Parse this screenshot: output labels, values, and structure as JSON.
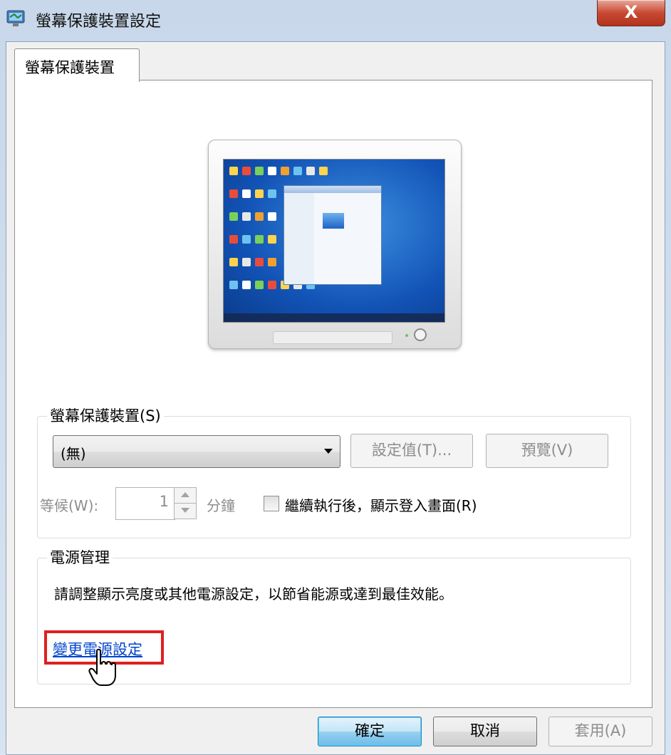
{
  "window": {
    "title": "螢幕保護裝置設定",
    "close_label": "X"
  },
  "tab": {
    "label": "螢幕保護裝置"
  },
  "screensaver": {
    "legend": "螢幕保護裝置(S)",
    "selected": "(無)",
    "settings_label": "設定值(T)...",
    "preview_label": "預覽(V)",
    "wait_label": "等候(W):",
    "wait_value": "1",
    "minutes_label": "分鐘",
    "resume_label": "繼續執行後，顯示登入畫面(R)"
  },
  "power": {
    "legend": "電源管理",
    "description": "請調整顯示亮度或其他電源設定，以節省能源或達到最佳效能。",
    "link_label": "變更電源設定"
  },
  "footer": {
    "ok_label": "確定",
    "cancel_label": "取消",
    "apply_label": "套用(A)"
  }
}
